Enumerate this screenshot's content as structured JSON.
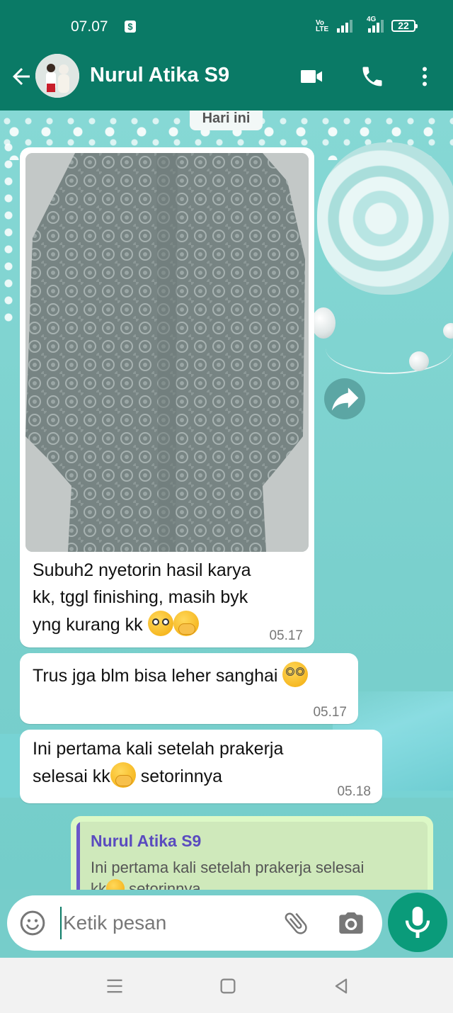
{
  "status": {
    "time": "07.07",
    "volte": "Vo\nLTE",
    "network": "4G",
    "battery": "22"
  },
  "header": {
    "contact_name": "Nurul Atika S9"
  },
  "chat": {
    "date_label": "Hari ini",
    "messages": [
      {
        "line1": "Subuh2 nyetorin hasil karya",
        "line2": "kk, tggl finishing, masih byk",
        "line3": "yng kurang kk",
        "time": "05.17"
      },
      {
        "text": "Trus jga blm bisa leher sanghai",
        "time": "05.17"
      },
      {
        "line1": "Ini pertama kali setelah prakerja",
        "line2a": "selesai kk",
        "line2b": " setorinnya",
        "time": "05.18"
      }
    ],
    "reply": {
      "name": "Nurul Atika S9",
      "line1": "Ini pertama kali setelah prakerja selesai",
      "line2a": "kk",
      "line2b": " setorinnya"
    }
  },
  "composer": {
    "placeholder": "Ketik pesan"
  }
}
